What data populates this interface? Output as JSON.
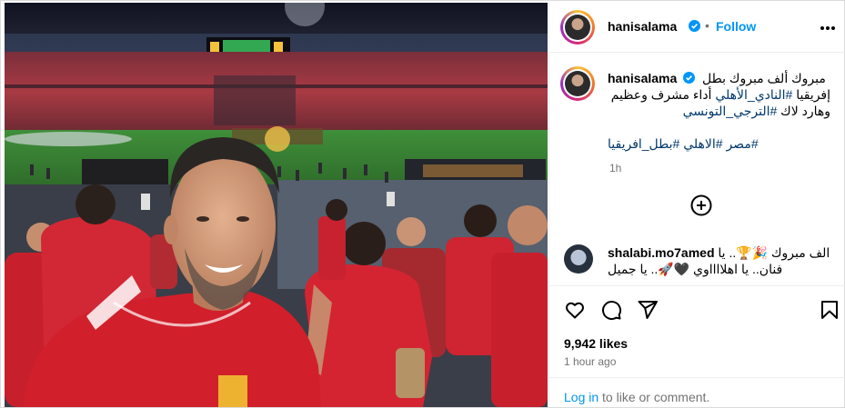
{
  "post": {
    "username": "hanisalama",
    "follow_label": "Follow",
    "caption": {
      "username": "hanisalama",
      "line1": "مبروك ألف مبروك بطل",
      "line2_plain": "إفريقيا",
      "line2_tag": "#النادي_الأهلي",
      "line2_rest": "أداء مشرف وعظيم",
      "line3_plain": "وهارد لاك",
      "line3_tag": "#الترجي_التونسي",
      "hashtags": "#مصر #الاهلي #بطل_افريقيا"
    },
    "posted_time": "1h",
    "likes": "9,942 likes",
    "time_ago": "1 hour ago"
  },
  "comment": {
    "username": "shalabi.mo7amed",
    "line1": "الف مبروك 🎉🏆.. يا",
    "line2": "فنان.. يا اهلااااوي 🖤🚀.. يا جميل"
  },
  "footer": {
    "login_link": "Log in",
    "login_rest": " to like or comment."
  },
  "icons": {
    "verified": "verified-badge-icon",
    "more": "more-options-icon",
    "add": "add-circle-icon",
    "like": "heart-icon",
    "comment": "comment-icon",
    "share": "share-icon",
    "save": "bookmark-icon"
  },
  "colors": {
    "accent": "#0095f6",
    "hashtag": "#00376b",
    "muted": "#737373",
    "jersey": "#d11f2b"
  }
}
